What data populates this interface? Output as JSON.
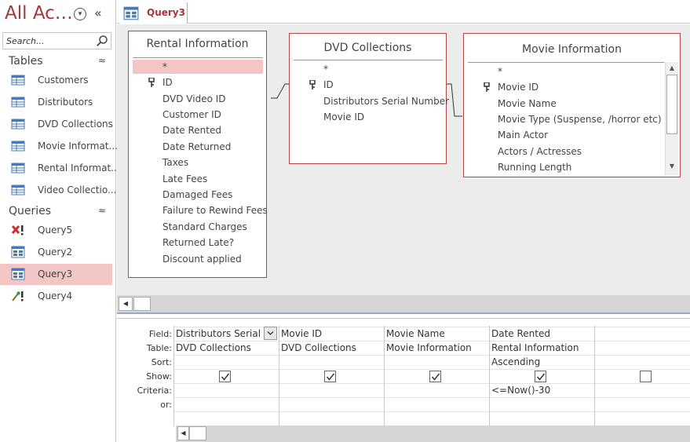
{
  "nav": {
    "title": "All Ac…",
    "search_placeholder": "Search...",
    "groups": [
      {
        "label": "Tables",
        "items": [
          {
            "label": "Customers",
            "icon": "table-icon"
          },
          {
            "label": "Distributors",
            "icon": "table-icon"
          },
          {
            "label": "DVD Collections",
            "icon": "table-icon"
          },
          {
            "label": "Movie Informat...",
            "icon": "table-icon"
          },
          {
            "label": "Rental Informat...",
            "icon": "table-icon"
          },
          {
            "label": "Video Collectio...",
            "icon": "table-icon"
          }
        ]
      },
      {
        "label": "Queries",
        "items": [
          {
            "label": "Query5",
            "icon": "delete-query-icon"
          },
          {
            "label": "Query2",
            "icon": "select-query-icon"
          },
          {
            "label": "Query3",
            "icon": "select-query-icon",
            "selected": true
          },
          {
            "label": "Query4",
            "icon": "update-query-icon"
          }
        ]
      }
    ]
  },
  "tab": {
    "label": "Query3"
  },
  "tables": {
    "rental": {
      "title": "Rental Information",
      "fields": [
        "*",
        "ID",
        "DVD Video ID",
        "Customer ID",
        "Date Rented",
        "Date Returned",
        "Taxes",
        "Late Fees",
        "Damaged Fees",
        "Failure to Rewind Fees",
        "Standard Charges",
        "Returned Late?",
        "Discount applied"
      ]
    },
    "dvd": {
      "title": "DVD Collections",
      "fields": [
        "*",
        "ID",
        "Distributors Serial Number",
        "Movie ID"
      ]
    },
    "movie": {
      "title": "Movie Information",
      "fields": [
        "*",
        "Movie ID",
        "Movie Name",
        "Movie Type (Suspense, /horror etc)",
        "Main Actor",
        "Actors / Actresses",
        "Running Length"
      ]
    }
  },
  "grid": {
    "row_labels": {
      "field": "Field:",
      "table": "Table:",
      "sort": "Sort:",
      "show": "Show:",
      "criteria": "Criteria:",
      "or": "or:"
    },
    "columns": [
      {
        "field": "Distributors Serial N",
        "table": "DVD Collections",
        "sort": "",
        "show": true,
        "criteria": ""
      },
      {
        "field": "Movie ID",
        "table": "DVD Collections",
        "sort": "",
        "show": true,
        "criteria": ""
      },
      {
        "field": "Movie Name",
        "table": "Movie Information",
        "sort": "",
        "show": true,
        "criteria": ""
      },
      {
        "field": "Date Rented",
        "table": "Rental Information",
        "sort": "Ascending",
        "show": true,
        "criteria": "<=Now()-30"
      },
      {
        "field": "",
        "table": "",
        "sort": "",
        "show": false,
        "criteria": ""
      }
    ]
  },
  "colors": {
    "accent": "#a4373a",
    "selection": "#f4c5c5",
    "table_border": "#b54545"
  }
}
